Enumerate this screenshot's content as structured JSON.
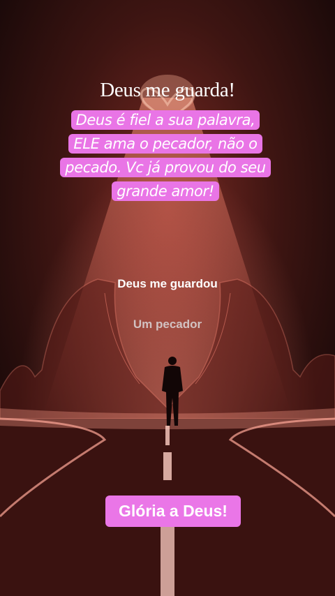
{
  "title": "Deus me guarda!",
  "message": "Deus é fiel a sua palavra, ELE ama o pecador, não o pecado. Vc já provou do seu grande amor!",
  "subtitle_1": "Deus me guardou",
  "subtitle_2": "Um pecador",
  "badge": "Glória a Deus!",
  "colors": {
    "highlight": "#e975e6",
    "background": "#1a0a0a",
    "glow": "#ff6a5a"
  }
}
